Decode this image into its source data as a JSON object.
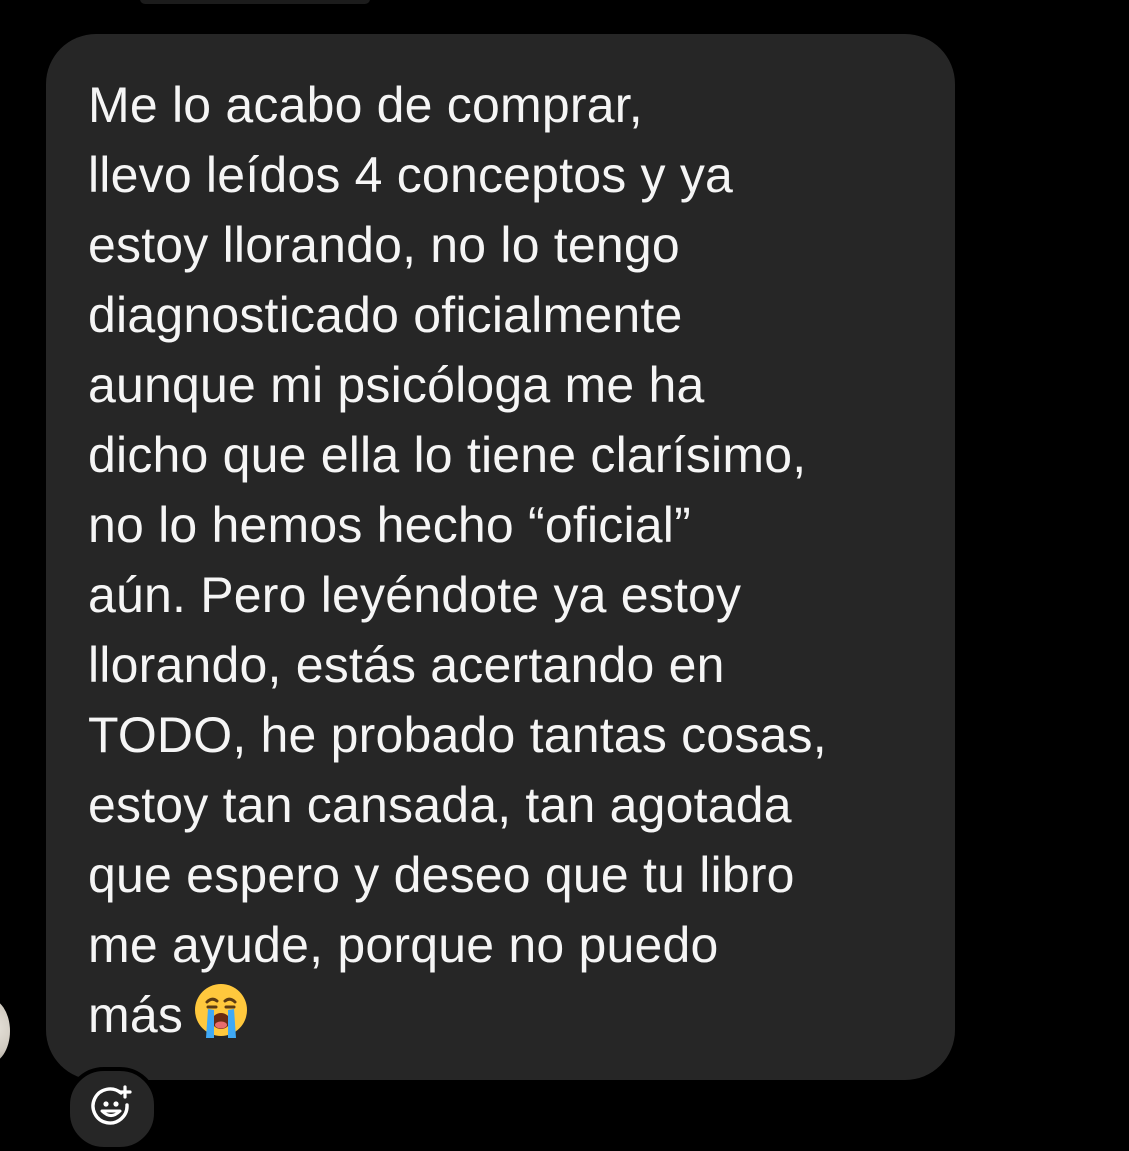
{
  "message": {
    "lines": [
      "Me lo acabo de comprar,",
      "llevo leídos 4 conceptos y ya",
      "estoy llorando, no lo tengo",
      "diagnosticado oficialmente",
      "aunque mi psicóloga me ha",
      "dicho que ella lo tiene clarísimo,",
      "no lo hemos hecho “oficial”",
      "aún. Pero leyéndote ya estoy",
      "llorando, estás acertando en",
      "TODO, he probado tantas cosas,",
      "estoy tan cansada, tan agotada",
      "que espero y deseo que tu libro",
      "me ayude, porque no puedo",
      "más"
    ],
    "trailing_emoji": "loudly-crying-face"
  },
  "reaction": {
    "icon": "add-reaction-icon"
  },
  "colors": {
    "background": "#000000",
    "bubble": "#262626",
    "text": "#f5f5f5"
  }
}
